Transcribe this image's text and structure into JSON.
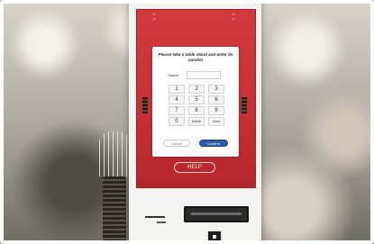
{
  "dialog": {
    "title": "Please take a table stand and enter its number",
    "number_label": "Num#",
    "number_value": "",
    "keys": [
      "1",
      "2",
      "3",
      "4",
      "5",
      "6",
      "7",
      "8",
      "9",
      "0",
      "Delete",
      "Clear"
    ],
    "cancel_label": "Cancel",
    "confirm_label": "Confirm"
  },
  "screen": {
    "help_label": "HELP",
    "accent_color": "#c62f34",
    "confirm_color": "#2a5aa8"
  }
}
